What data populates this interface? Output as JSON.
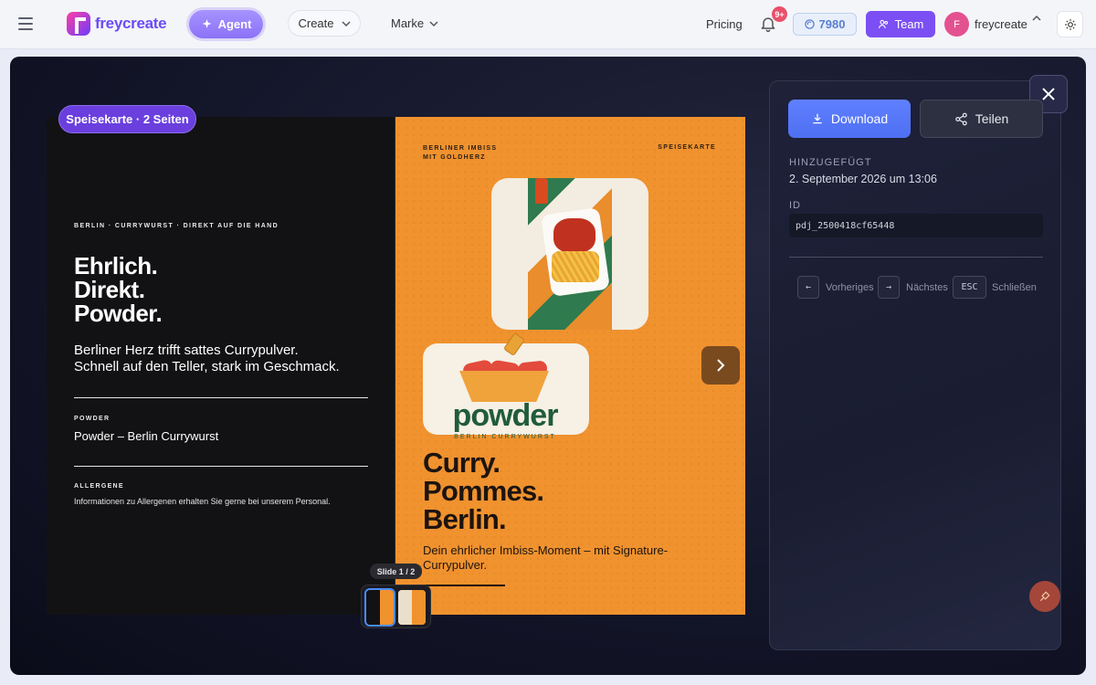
{
  "nav": {
    "logo_text": "freycreate",
    "agent_label": "Agent",
    "create_label": "Create",
    "marke_label": "Marke",
    "pricing_label": "Pricing",
    "notifications_badge": "9+",
    "credits": "7980",
    "team_label": "Team",
    "user_initial": "F",
    "user_name": "freycreate"
  },
  "viewer": {
    "pages_badge": "Speisekarte · 2 Seiten",
    "slide_label": "Slide 1 / 2",
    "left_page": {
      "eyebrow": "BERLIN · CURRYWURST · DIREKT AUF DIE HAND",
      "headline_1": "Ehrlich.",
      "headline_2": "Direkt.",
      "headline_3": "Powder.",
      "sub_1": "Berliner Herz trifft sattes Currypulver.",
      "sub_2": "Schnell auf den Teller, stark im Geschmack.",
      "label_1": "POWDER",
      "value_1": "Powder – Berlin Currywurst",
      "label_2": "ALLERGENE",
      "value_2": "Informationen zu Allergenen erhalten Sie gerne bei unserem Personal."
    },
    "right_page": {
      "top_left_1": "BERLINER IMBISS",
      "top_left_2": "MIT GOLDHERZ",
      "top_right": "SPEISEKARTE",
      "logo_word": "powder",
      "logo_under": "BERLIN CURRYWURST",
      "headline_1": "Curry.",
      "headline_2": "Pommes.",
      "headline_3": "Berlin.",
      "sub": "Dein ehrlicher Imbiss-Moment – mit Signature-Currypulver."
    }
  },
  "panel": {
    "download_label": "Download",
    "share_label": "Teilen",
    "added_label": "HINZUGEFÜGT",
    "added_value": "2. September 2026 um 13:06",
    "id_label": "ID",
    "id_value": "pdj_2500418cf65448",
    "prev_key": "←",
    "prev_label": "Vorheriges",
    "next_key": "→",
    "next_label": "Nächstes",
    "esc_key": "ESC",
    "esc_label": "Schließen"
  },
  "colors": {
    "accent": "#7b4ff3",
    "download": "#4f6ff2",
    "menu_orange": "#f0922e"
  }
}
